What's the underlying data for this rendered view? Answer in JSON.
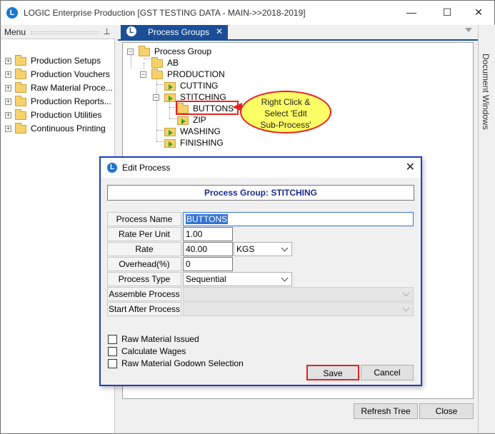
{
  "window": {
    "title": "LOGIC Enterprise Production  [GST TESTING DATA - MAIN->>2018-2019]",
    "logo_letter": "L"
  },
  "menu": {
    "title": "Menu",
    "items": [
      {
        "label": "Production Setups"
      },
      {
        "label": "Production Vouchers"
      },
      {
        "label": "Raw Material Proce..."
      },
      {
        "label": "Production  Reports..."
      },
      {
        "label": "Production Utilities"
      },
      {
        "label": "Continuous Printing"
      }
    ]
  },
  "tab": {
    "label": "Process Groups",
    "close": "✕"
  },
  "side_panel": {
    "label": "Document Windows"
  },
  "tree": {
    "root": "Process Group",
    "nodes": {
      "ab": "AB",
      "production": "PRODUCTION",
      "cutting": "CUTTING",
      "stitching": "STITCHING",
      "buttons": "BUTTONS",
      "zip": "ZIP",
      "washing": "WASHING",
      "finishing": "FINISHING"
    }
  },
  "callout": {
    "line1": "Right Click &",
    "line2": "Select 'Edit",
    "line3": "Sub-Process'"
  },
  "buttons": {
    "refresh": "Refresh Tree",
    "close": "Close"
  },
  "dialog": {
    "title": "Edit Process",
    "group_header": "Process Group: STITCHING",
    "labels": {
      "process_name": "Process Name",
      "rate_per_unit": "Rate Per Unit",
      "rate": "Rate",
      "overhead": "Overhead(%)",
      "process_type": "Process Type",
      "assemble_process": "Assemble Process",
      "start_after_process": "Start After Process"
    },
    "values": {
      "process_name": "BUTTONS",
      "rate_per_unit": "1.00",
      "rate": "40.00",
      "rate_unit": "KGS",
      "overhead": "0",
      "process_type": "Sequential",
      "assemble_process": "",
      "start_after_process": ""
    },
    "checkboxes": [
      {
        "label": "Raw Material Issued",
        "checked": false
      },
      {
        "label": "Calculate Wages",
        "checked": false
      },
      {
        "label": "Raw Material Godown Selection",
        "checked": false
      }
    ],
    "save_label": "Save",
    "cancel_label": "Cancel"
  },
  "colors": {
    "accent": "#1a4f98",
    "highlight": "#e52320",
    "callout_fill": "#ffff66",
    "dialog_border": "#1b3fc0"
  }
}
